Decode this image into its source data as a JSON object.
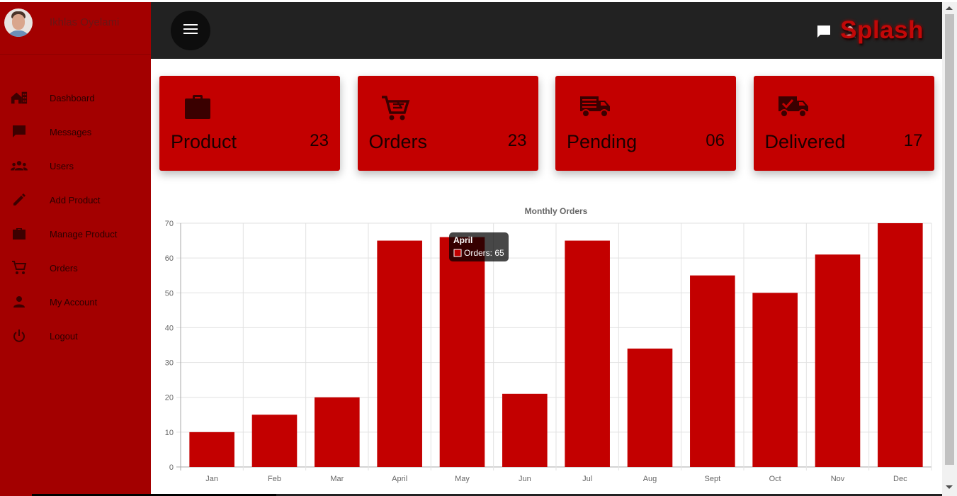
{
  "user": {
    "name": "Ikhlas Oyelami"
  },
  "brand": "Splash",
  "nav": [
    {
      "label": "Dashboard",
      "icon": "dashboard-icon"
    },
    {
      "label": "Messages",
      "icon": "message-icon"
    },
    {
      "label": "Users",
      "icon": "users-icon"
    },
    {
      "label": "Add Product",
      "icon": "pencil-icon"
    },
    {
      "label": "Manage Product",
      "icon": "briefcase-icon"
    },
    {
      "label": "Orders",
      "icon": "cart-icon"
    },
    {
      "label": "My Account",
      "icon": "person-icon"
    },
    {
      "label": "Logout",
      "icon": "power-icon"
    }
  ],
  "cards": [
    {
      "title": "Product",
      "value": "23",
      "icon": "briefcase-icon"
    },
    {
      "title": "Orders",
      "value": "23",
      "icon": "cart-icon"
    },
    {
      "title": "Pending",
      "value": "06",
      "icon": "truck-icon"
    },
    {
      "title": "Delivered",
      "value": "17",
      "icon": "truck-check-icon"
    }
  ],
  "colors": {
    "sidebar": "#a30000",
    "card": "#c30000",
    "bar": "#c30000",
    "topbar": "#222222"
  },
  "chart_data": {
    "type": "bar",
    "title": "Monthly Orders",
    "categories": [
      "Jan",
      "Feb",
      "Mar",
      "April",
      "May",
      "Jun",
      "Jul",
      "Aug",
      "Sept",
      "Oct",
      "Nov",
      "Dec"
    ],
    "series": [
      {
        "name": "Orders",
        "values": [
          10,
          15,
          20,
          65,
          66,
          21,
          65,
          34,
          55,
          50,
          61,
          70
        ]
      }
    ],
    "ylim": [
      0,
      70
    ],
    "yticks": [
      0,
      10,
      20,
      30,
      40,
      50,
      60,
      70
    ],
    "grid": true,
    "tooltip": {
      "title": "April",
      "text": "Orders: 65"
    }
  }
}
